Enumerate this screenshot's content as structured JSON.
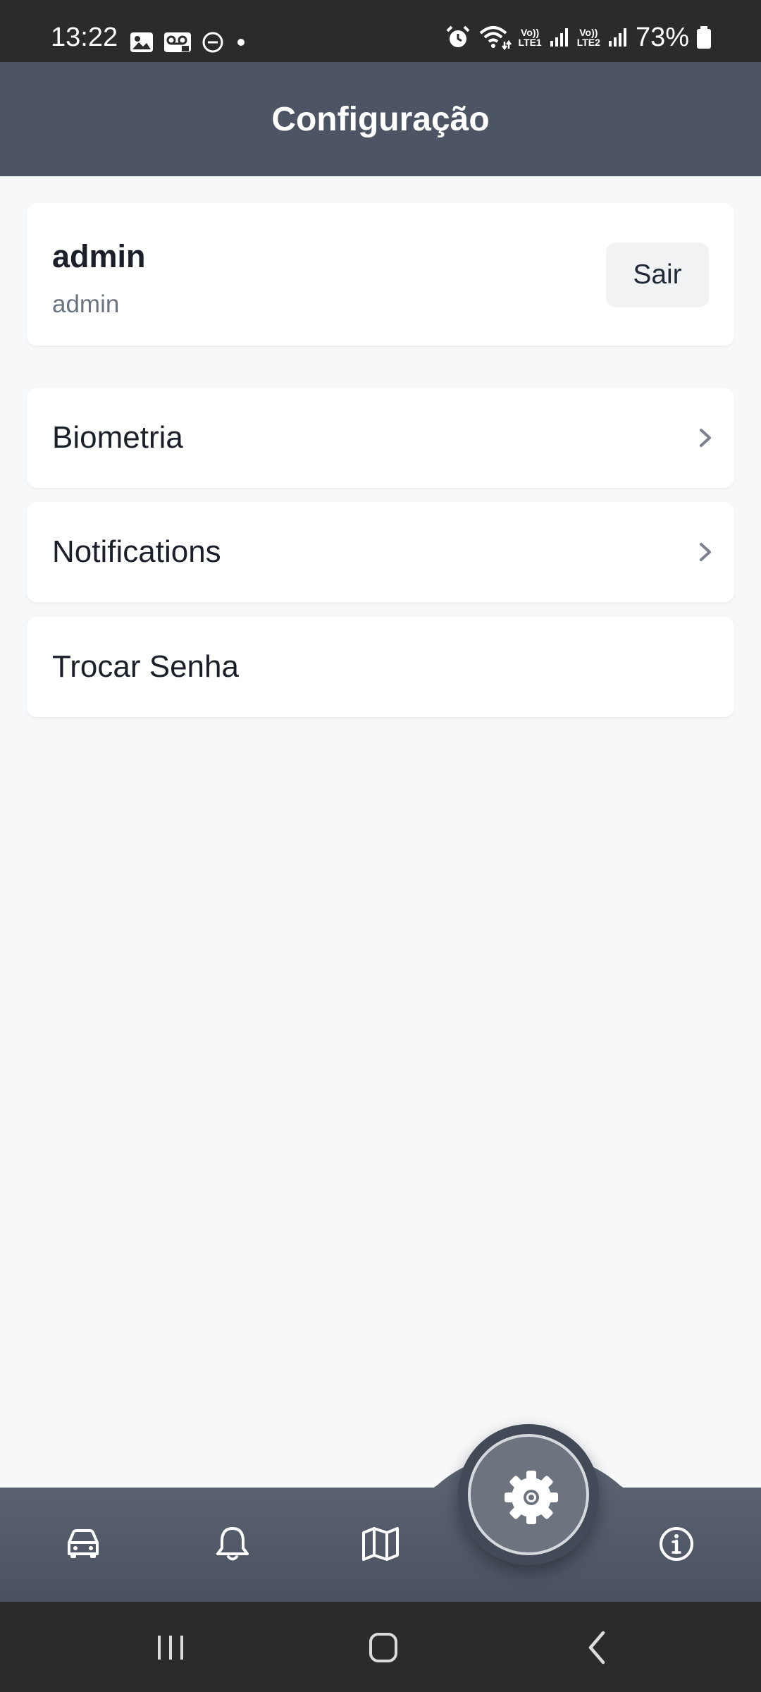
{
  "status_bar": {
    "time": "13:22",
    "battery": "73%",
    "sim1": {
      "top": "Vo))",
      "bottom": "LTE1"
    },
    "sim2": {
      "top": "Vo))",
      "bottom": "LTE2"
    },
    "icons": [
      "image-icon",
      "voicemail-icon",
      "do-not-disturb-icon",
      "dot-icon",
      "alarm-icon",
      "wifi-icon",
      "signal-icon",
      "battery-icon"
    ]
  },
  "header": {
    "title": "Configuração"
  },
  "profile": {
    "name": "admin",
    "subtitle": "admin",
    "logout_label": "Sair"
  },
  "menu": {
    "items": [
      {
        "label": "Biometria",
        "has_chevron": true
      },
      {
        "label": "Notifications",
        "has_chevron": true
      },
      {
        "label": "Trocar Senha",
        "has_chevron": false
      }
    ]
  },
  "bottom_nav": {
    "items": [
      "car-icon",
      "bell-icon",
      "map-icon",
      "settings-icon",
      "info-icon"
    ],
    "active": "settings-icon"
  },
  "colors": {
    "header_bg": "#4d5564",
    "page_bg": "#f7f8fa",
    "card_bg": "#ffffff",
    "status_bar_bg": "#2b2b2b"
  }
}
